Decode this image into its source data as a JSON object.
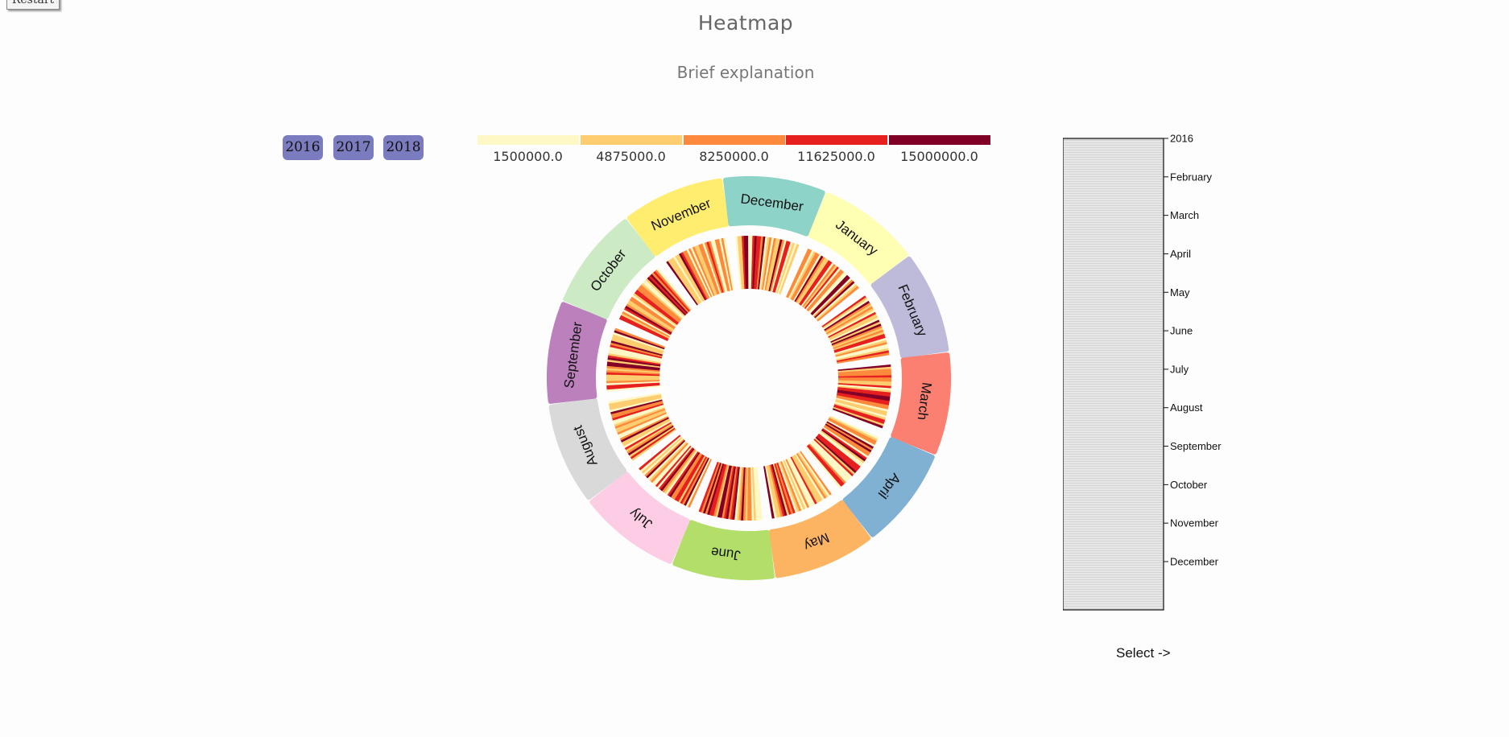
{
  "header": {
    "restart_label": "Restart",
    "title": "Heatmap",
    "subtitle": "Brief explanation"
  },
  "years": [
    "2016",
    "2017",
    "2018"
  ],
  "legend": {
    "colors": [
      "#fef7c6",
      "#fecd70",
      "#fd8a3c",
      "#e61f1f",
      "#800026"
    ],
    "labels": [
      "1500000.0",
      "4875000.0",
      "8250000.0",
      "11625000.0",
      "15000000.0"
    ]
  },
  "wheel": {
    "months": [
      {
        "name": "January",
        "color": "#ffffb3"
      },
      {
        "name": "February",
        "color": "#bebada"
      },
      {
        "name": "March",
        "color": "#fb8072"
      },
      {
        "name": "April",
        "color": "#80b1d3"
      },
      {
        "name": "May",
        "color": "#fdb462"
      },
      {
        "name": "June",
        "color": "#b3de69"
      },
      {
        "name": "July",
        "color": "#fccde5"
      },
      {
        "name": "August",
        "color": "#d9d9d9"
      },
      {
        "name": "September",
        "color": "#bc80bd"
      },
      {
        "name": "October",
        "color": "#ccebc5"
      },
      {
        "name": "November",
        "color": "#ffed6f"
      },
      {
        "name": "December",
        "color": "#8dd3c7"
      }
    ]
  },
  "timeline": {
    "ticks": [
      "2016",
      "February",
      "March",
      "April",
      "May",
      "June",
      "July",
      "August",
      "September",
      "October",
      "November",
      "December"
    ]
  },
  "select_label": "Select ->"
}
